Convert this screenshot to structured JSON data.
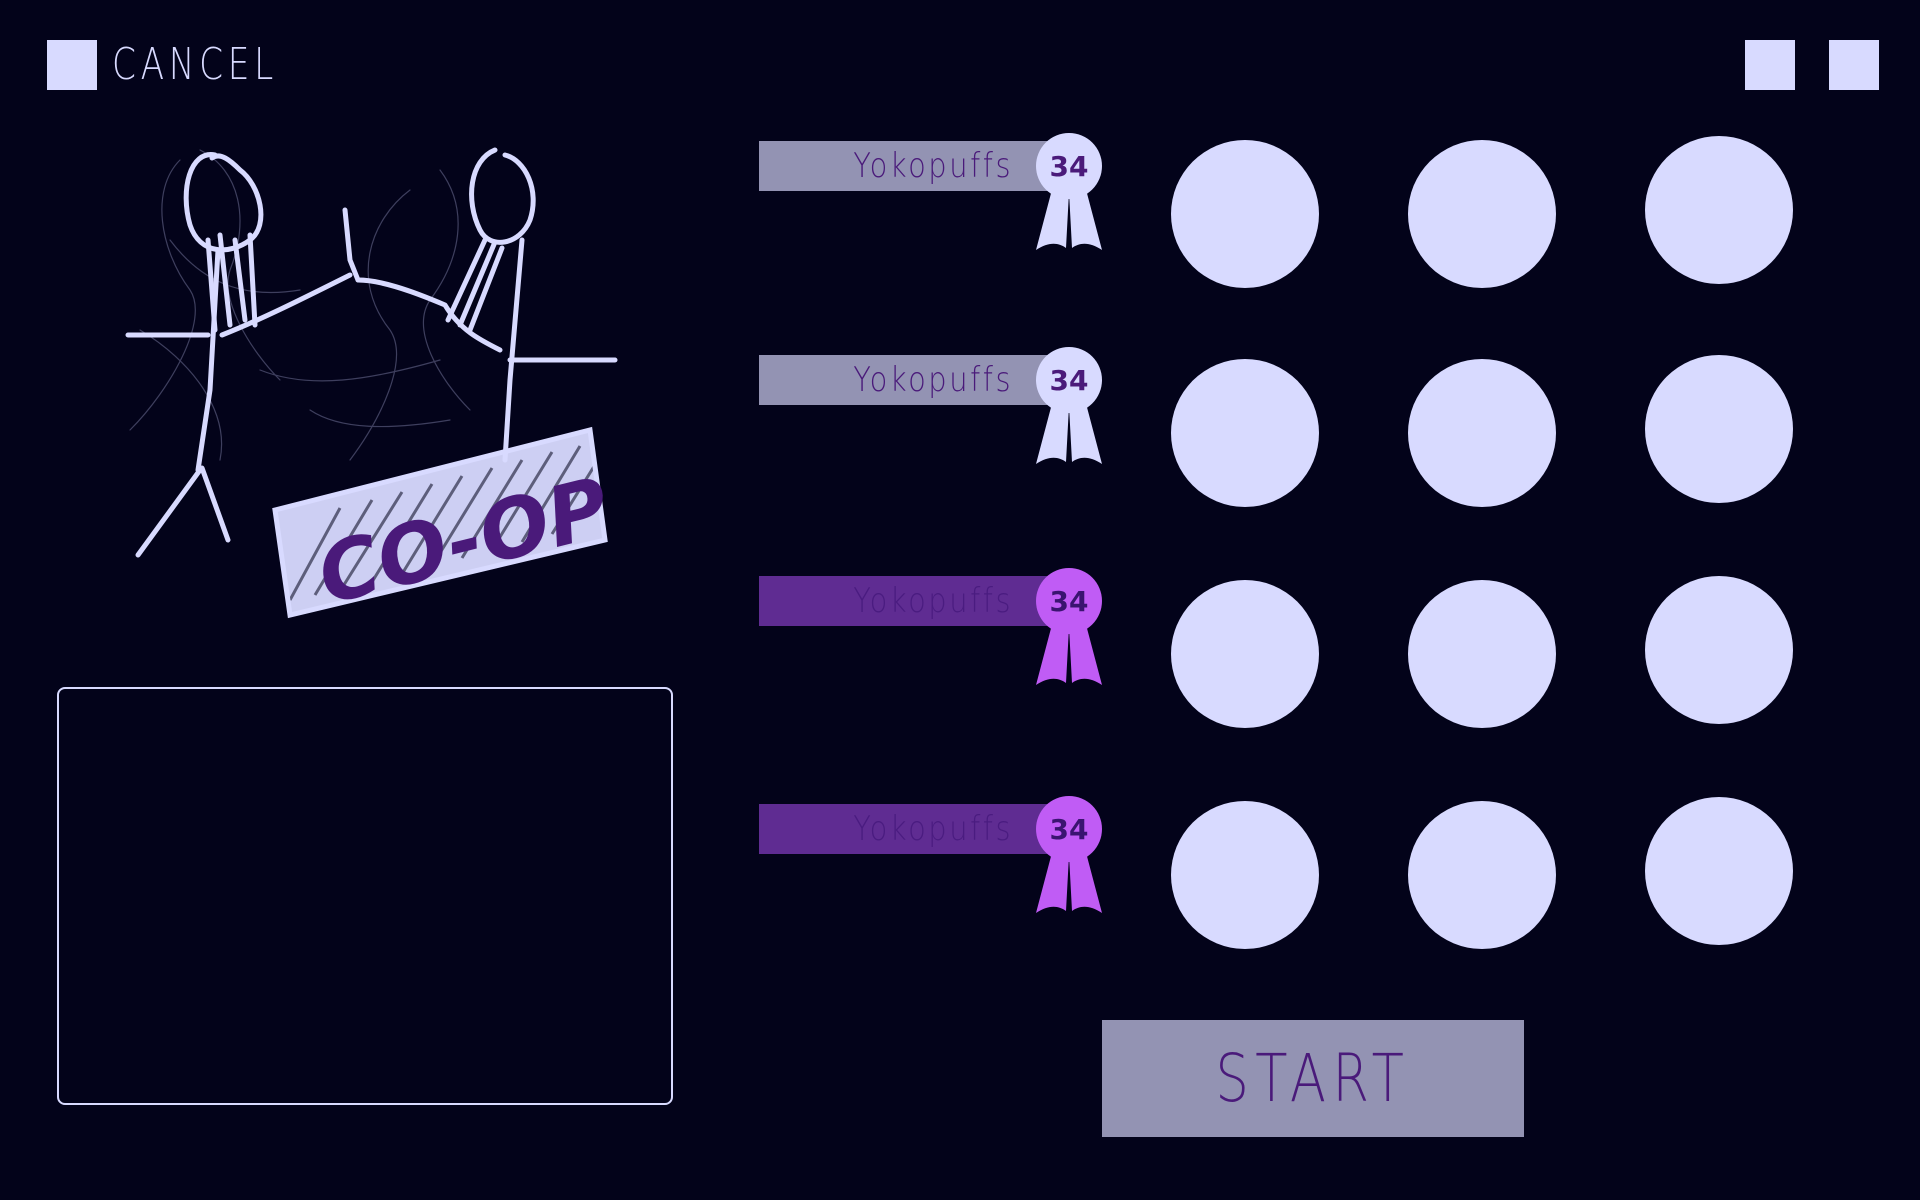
{
  "top_bar": {
    "cancel_label": "CANCEL"
  },
  "coop_art": {
    "label": "CO-OP"
  },
  "players": [
    {
      "name": "Yokopuffs",
      "level": "34",
      "active": false
    },
    {
      "name": "Yokopuffs",
      "level": "34",
      "active": false
    },
    {
      "name": "Yokopuffs",
      "level": "34",
      "active": true
    },
    {
      "name": "Yokopuffs",
      "level": "34",
      "active": true
    }
  ],
  "start_label": "START",
  "colors": {
    "background": "#03031a",
    "light": "#d8daff",
    "inactive_bar": "#9393b3",
    "active_bar": "#5f2c92",
    "active_ribbon": "#c05cf5",
    "text_purple": "#4a1a7a"
  }
}
